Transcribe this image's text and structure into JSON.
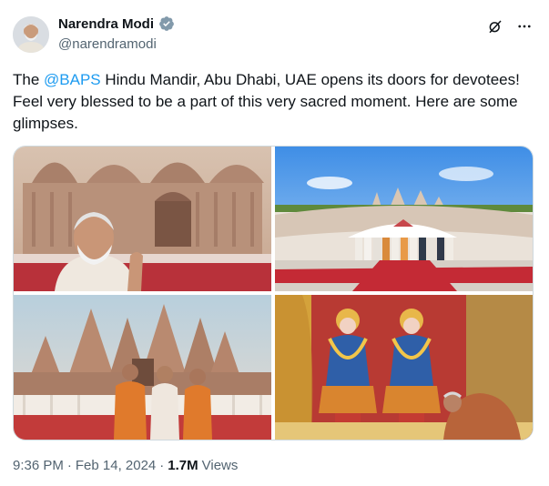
{
  "author": {
    "name": "Narendra Modi",
    "handle": "@narendramodi"
  },
  "tweet": {
    "text_before": "The ",
    "mention": "@BAPS",
    "text_after": " Hindu Mandir, Abu Dhabi, UAE opens its doors for devotees! Feel very blessed to be a part of this very sacred moment. Here are some glimpses."
  },
  "footer": {
    "time": "9:36 PM",
    "date": "Feb 14, 2024",
    "views_count": "1.7M",
    "views_label": "Views"
  },
  "icons": {
    "verified": "verified-badge-icon",
    "grok": "grok-icon",
    "more": "more-options-icon"
  },
  "colors": {
    "accent": "#1d9bf0",
    "secondary_text": "#536471"
  }
}
